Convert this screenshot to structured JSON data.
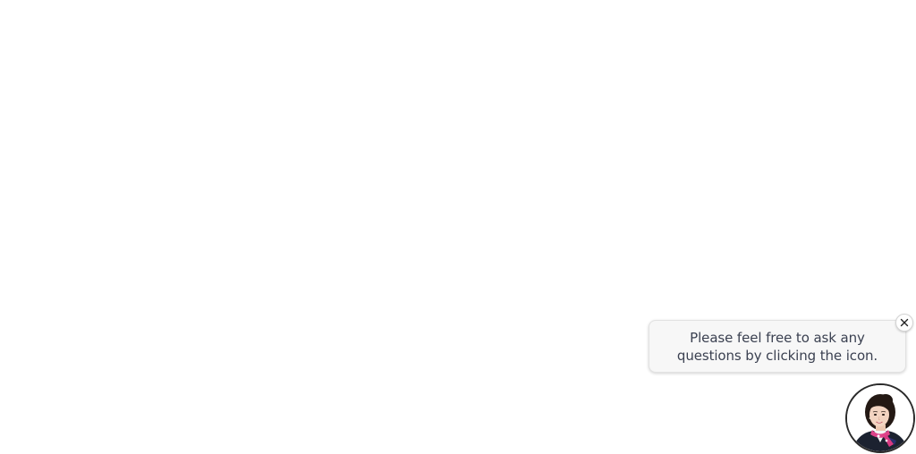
{
  "chat_prompt": {
    "message": "Please feel free to ask any questions by clicking the icon.",
    "close_icon": "close-icon",
    "avatar_icon": "assistant-avatar"
  }
}
